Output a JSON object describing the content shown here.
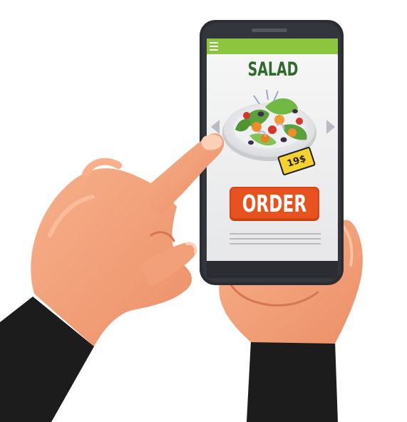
{
  "menu": {
    "icon": "hamburger-menu-icon"
  },
  "product": {
    "title": "SALAD",
    "price": "19$",
    "image": "salad-plate-icon"
  },
  "actions": {
    "order_label": "ORDER"
  },
  "navigation": {
    "prev_icon": "chevron-left-icon",
    "next_icon": "chevron-right-icon"
  },
  "colors": {
    "header_bar": "#8cc63f",
    "title": "#2e6b2a",
    "order_button": "#e8521f",
    "price_tag": "#f6d22e",
    "phone_body": "#2b2d33",
    "skin": "#f4a47c",
    "sleeve": "#1c1c1c"
  }
}
